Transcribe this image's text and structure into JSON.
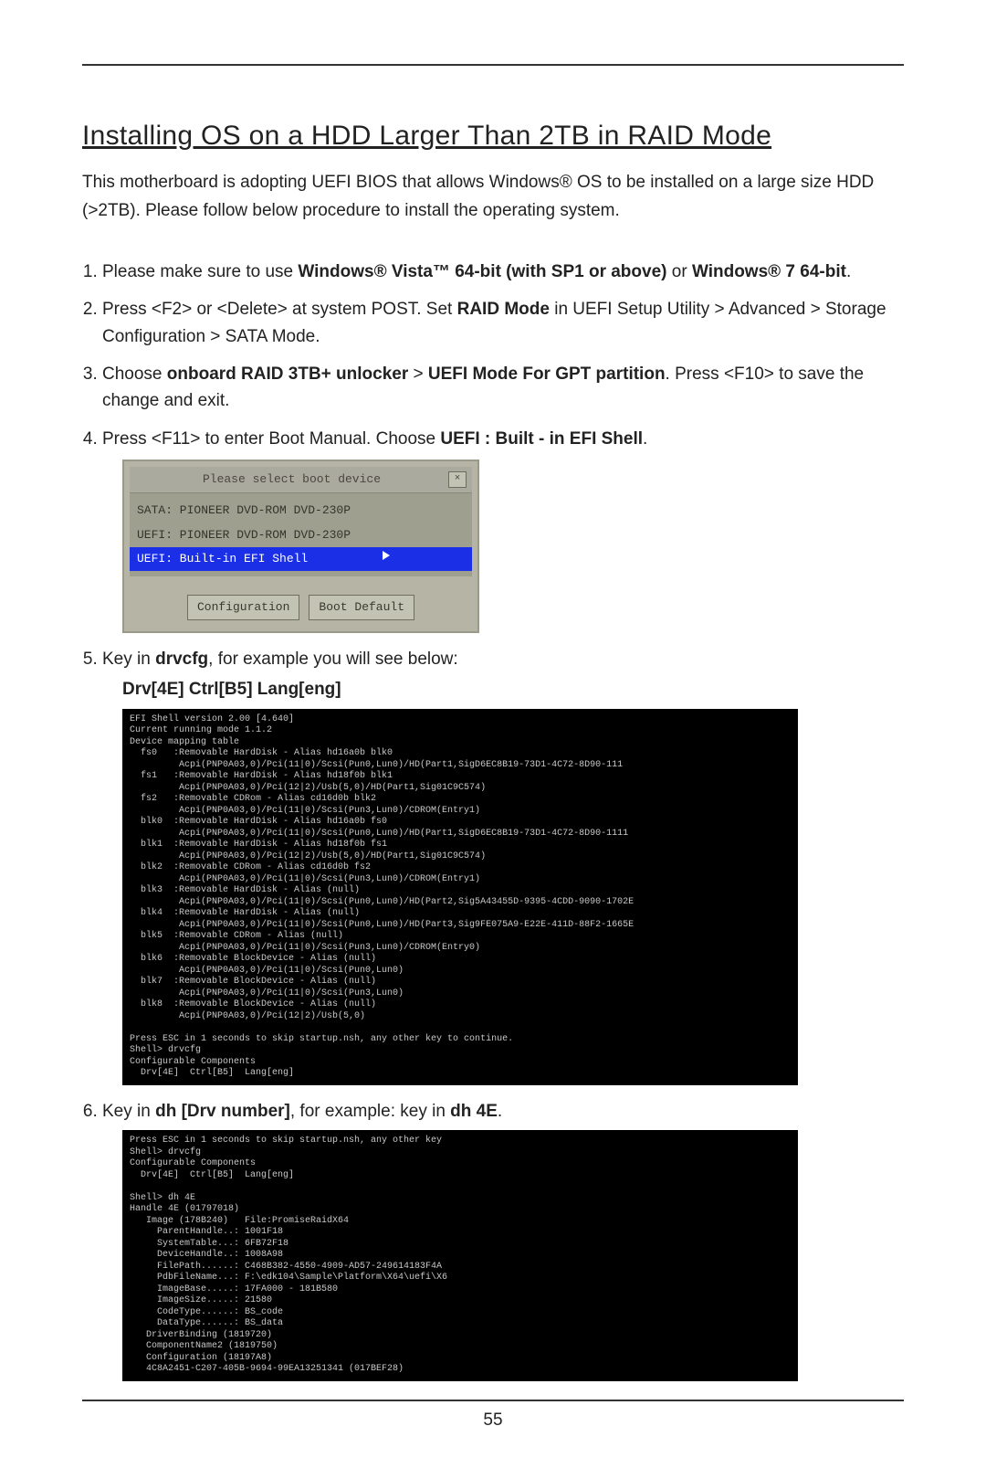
{
  "title": "Installing OS on a HDD Larger Than 2TB in RAID Mode",
  "intro": "This motherboard is adopting UEFI BIOS that allows Windows® OS to be installed on a large size HDD (>2TB). Please follow below procedure to install the operating system.",
  "steps": {
    "s1a": "Please make sure to use ",
    "s1b": "Windows® Vista™ 64-bit (with SP1 or above)",
    "s1c": " or ",
    "s1d": "Windows® 7 64-bit",
    "s1e": ".",
    "s2a": "Press <F2> or <Delete> at system POST. Set ",
    "s2b": "RAID Mode",
    "s2c": " in UEFI Setup Utility > Advanced > Storage Configuration > SATA Mode.",
    "s3a": "Choose ",
    "s3b": "onboard RAID 3TB+ unlocker",
    "s3c": " > ",
    "s3d": "UEFI Mode For GPT partition",
    "s3e": ". Press <F10> to save the change and exit.",
    "s4a": "Press <F11> to enter Boot Manual. Choose ",
    "s4b": "UEFI : Built - in EFI Shell",
    "s4c": ".",
    "s5a": "Key in ",
    "s5b": "drvcfg",
    "s5c": ", for example you will see below:",
    "s5d": "Drv[4E]   Ctrl[B5]   Lang[eng]",
    "s6a": "Key in ",
    "s6b": "dh [Drv number]",
    "s6c": ", for example: key in ",
    "s6d": "dh 4E",
    "s6e": "."
  },
  "shot1": {
    "header": "Please select boot device",
    "close": "×",
    "opt1": "SATA: PIONEER DVD-ROM DVD-230P",
    "opt2": "UEFI: PIONEER DVD-ROM DVD-230P",
    "opt3": "UEFI: Built-in EFI Shell",
    "btn1": "Configuration",
    "btn2": "Boot Default"
  },
  "shell1": "EFI Shell version 2.00 [4.640]\nCurrent running mode 1.1.2\nDevice mapping table\n  fs0   :Removable HardDisk - Alias hd16a0b blk0\n         Acpi(PNP0A03,0)/Pci(11|0)/Scsi(Pun0,Lun0)/HD(Part1,SigD6EC8B19-73D1-4C72-8D90-111\n  fs1   :Removable HardDisk - Alias hd18f0b blk1\n         Acpi(PNP0A03,0)/Pci(12|2)/Usb(5,0)/HD(Part1,Sig01C9C574)\n  fs2   :Removable CDRom - Alias cd16d0b blk2\n         Acpi(PNP0A03,0)/Pci(11|0)/Scsi(Pun3,Lun0)/CDROM(Entry1)\n  blk0  :Removable HardDisk - Alias hd16a0b fs0\n         Acpi(PNP0A03,0)/Pci(11|0)/Scsi(Pun0,Lun0)/HD(Part1,SigD6EC8B19-73D1-4C72-8D90-1111\n  blk1  :Removable HardDisk - Alias hd18f0b fs1\n         Acpi(PNP0A03,0)/Pci(12|2)/Usb(5,0)/HD(Part1,Sig01C9C574)\n  blk2  :Removable CDRom - Alias cd16d0b fs2\n         Acpi(PNP0A03,0)/Pci(11|0)/Scsi(Pun3,Lun0)/CDROM(Entry1)\n  blk3  :Removable HardDisk - Alias (null)\n         Acpi(PNP0A03,0)/Pci(11|0)/Scsi(Pun0,Lun0)/HD(Part2,Sig5A43455D-9395-4CDD-9090-1702E\n  blk4  :Removable HardDisk - Alias (null)\n         Acpi(PNP0A03,0)/Pci(11|0)/Scsi(Pun0,Lun0)/HD(Part3,Sig9FE075A9-E22E-411D-88F2-1665E\n  blk5  :Removable CDRom - Alias (null)\n         Acpi(PNP0A03,0)/Pci(11|0)/Scsi(Pun3,Lun0)/CDROM(Entry0)\n  blk6  :Removable BlockDevice - Alias (null)\n         Acpi(PNP0A03,0)/Pci(11|0)/Scsi(Pun0,Lun0)\n  blk7  :Removable BlockDevice - Alias (null)\n         Acpi(PNP0A03,0)/Pci(11|0)/Scsi(Pun3,Lun0)\n  blk8  :Removable BlockDevice - Alias (null)\n         Acpi(PNP0A03,0)/Pci(12|2)/Usb(5,0)\n\nPress ESC in 1 seconds to skip startup.nsh, any other key to continue.\nShell> drvcfg\nConfigurable Components\n  Drv[4E]  Ctrl[B5]  Lang[eng]",
  "shell2": "Press ESC in 1 seconds to skip startup.nsh, any other key\nShell> drvcfg\nConfigurable Components\n  Drv[4E]  Ctrl[B5]  Lang[eng]\n\nShell> dh 4E\nHandle 4E (01797018)\n   Image (178B240)   File:PromiseRaidX64\n     ParentHandle..: 1001F18\n     SystemTable...: 6FB72F18\n     DeviceHandle..: 1008A98\n     FilePath......: C468B382-4550-4909-AD57-249614183F4A\n     PdbFileName...: F:\\edk104\\Sample\\Platform\\X64\\uefi\\X6\n     ImageBase.....: 17FA000 - 181B580\n     ImageSize.....: 21580\n     CodeType......: BS_code\n     DataType......: BS_data\n   DriverBinding (1819720)\n   ComponentName2 (1819750)\n   Configuration (18197A8)\n   4C8A2451-C207-405B-9694-99EA13251341 (017BEF28)",
  "page_number": "55"
}
